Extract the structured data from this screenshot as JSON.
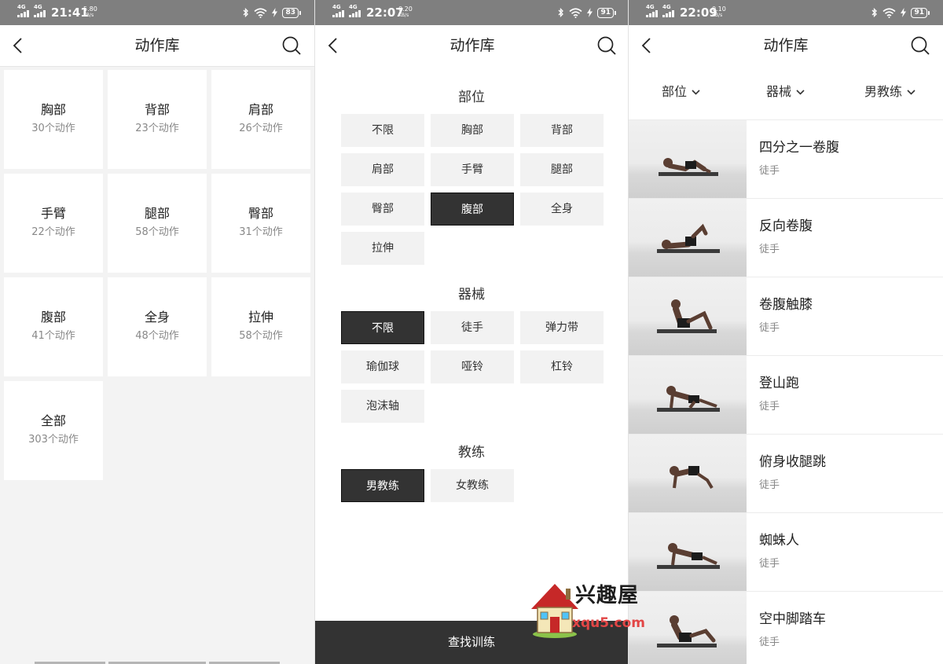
{
  "panels": [
    {
      "status": {
        "net1": "4G",
        "net2": "4G",
        "time": "21:41",
        "speed": "5.80",
        "speed_unit": "KB/s",
        "battery": "83"
      },
      "nav": {
        "title": "动作库"
      },
      "categories": [
        {
          "name": "胸部",
          "count": "30个动作"
        },
        {
          "name": "背部",
          "count": "23个动作"
        },
        {
          "name": "肩部",
          "count": "26个动作"
        },
        {
          "name": "手臂",
          "count": "22个动作"
        },
        {
          "name": "腿部",
          "count": "58个动作"
        },
        {
          "name": "臀部",
          "count": "31个动作"
        },
        {
          "name": "腹部",
          "count": "41个动作"
        },
        {
          "name": "全身",
          "count": "48个动作"
        },
        {
          "name": "拉伸",
          "count": "58个动作"
        },
        {
          "name": "全部",
          "count": "303个动作"
        }
      ]
    },
    {
      "status": {
        "net1": "4G",
        "net2": "4G",
        "time": "22:07",
        "speed": "0.20",
        "speed_unit": "KB/s",
        "battery": "91"
      },
      "nav": {
        "title": "动作库"
      },
      "sections": [
        {
          "title": "部位",
          "options": [
            "不限",
            "胸部",
            "背部",
            "肩部",
            "手臂",
            "腿部",
            "臀部",
            "腹部",
            "全身",
            "拉伸"
          ],
          "selected": 7
        },
        {
          "title": "器械",
          "options": [
            "不限",
            "徒手",
            "弹力带",
            "瑜伽球",
            "哑铃",
            "杠铃",
            "泡沫轴"
          ],
          "selected": 0
        },
        {
          "title": "教练",
          "options": [
            "男教练",
            "女教练"
          ],
          "selected": 0
        }
      ],
      "find_button": "查找训练"
    },
    {
      "status": {
        "net1": "4G",
        "net2": "4G",
        "time": "22:09",
        "speed": "0.10",
        "speed_unit": "KB/s",
        "battery": "91"
      },
      "nav": {
        "title": "动作库"
      },
      "filters": [
        "部位",
        "器械",
        "男教练"
      ],
      "exercises": [
        {
          "name": "四分之一卷腹",
          "equipment": "徒手",
          "pose": "crunch"
        },
        {
          "name": "反向卷腹",
          "equipment": "徒手",
          "pose": "reverse-crunch"
        },
        {
          "name": "卷腹触膝",
          "equipment": "徒手",
          "pose": "knee-touch"
        },
        {
          "name": "登山跑",
          "equipment": "徒手",
          "pose": "climber"
        },
        {
          "name": "俯身收腿跳",
          "equipment": "徒手",
          "pose": "tuck-jump"
        },
        {
          "name": "蜘蛛人",
          "equipment": "徒手",
          "pose": "spiderman"
        },
        {
          "name": "空中脚踏车",
          "equipment": "徒手",
          "pose": "bicycle"
        }
      ]
    }
  ],
  "watermark": {
    "brand": "兴趣屋",
    "url": "xqu5.com"
  },
  "colors": {
    "selected_bg": "#333333",
    "option_bg": "#f2f2f2",
    "status_bar": "#7f7f7f",
    "brand_red": "#e24646"
  }
}
